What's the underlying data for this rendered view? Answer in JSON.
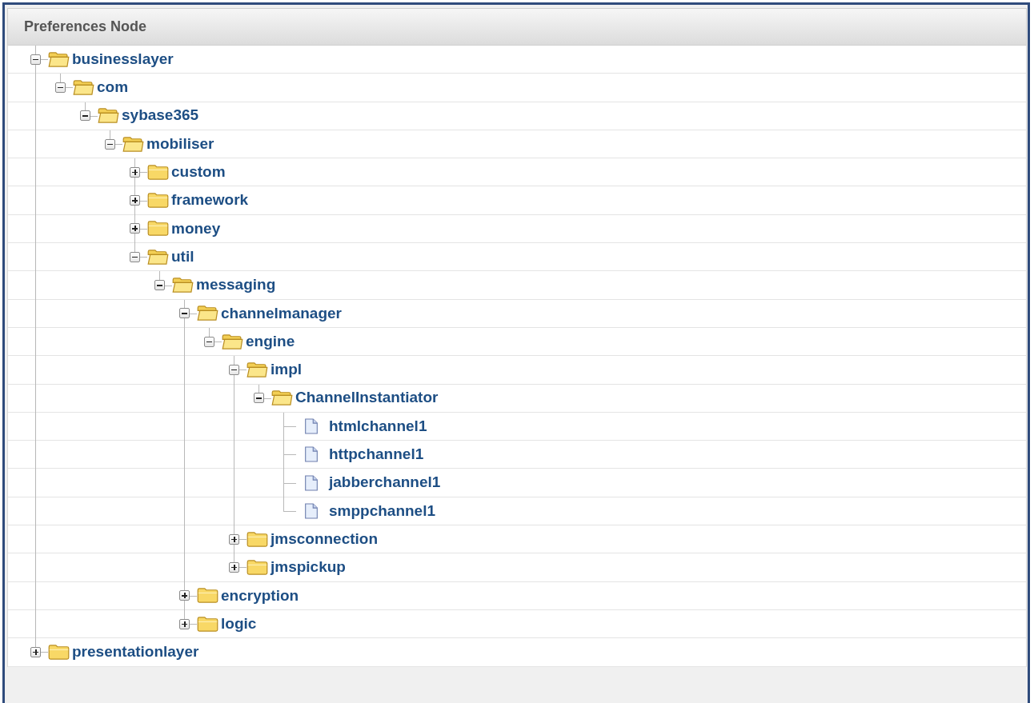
{
  "panel": {
    "title": "Preferences Node"
  },
  "tree": [
    {
      "name": "businesslayer",
      "kind": "folder",
      "expanded": true,
      "children": [
        {
          "name": "com",
          "kind": "folder",
          "expanded": true,
          "children": [
            {
              "name": "sybase365",
              "kind": "folder",
              "expanded": true,
              "children": [
                {
                  "name": "mobiliser",
                  "kind": "folder",
                  "expanded": true,
                  "children": [
                    {
                      "name": "custom",
                      "kind": "folder",
                      "expanded": false
                    },
                    {
                      "name": "framework",
                      "kind": "folder",
                      "expanded": false
                    },
                    {
                      "name": "money",
                      "kind": "folder",
                      "expanded": false
                    },
                    {
                      "name": "util",
                      "kind": "folder",
                      "expanded": true,
                      "children": [
                        {
                          "name": "messaging",
                          "kind": "folder",
                          "expanded": true,
                          "children": [
                            {
                              "name": "channelmanager",
                              "kind": "folder",
                              "expanded": true,
                              "children": [
                                {
                                  "name": "engine",
                                  "kind": "folder",
                                  "expanded": true,
                                  "children": [
                                    {
                                      "name": "impl",
                                      "kind": "folder",
                                      "expanded": true,
                                      "children": [
                                        {
                                          "name": "ChannelInstantiator",
                                          "kind": "folder",
                                          "expanded": true,
                                          "children": [
                                            {
                                              "name": "htmlchannel1",
                                              "kind": "file"
                                            },
                                            {
                                              "name": "httpchannel1",
                                              "kind": "file"
                                            },
                                            {
                                              "name": "jabberchannel1",
                                              "kind": "file"
                                            },
                                            {
                                              "name": "smppchannel1",
                                              "kind": "file"
                                            }
                                          ]
                                        }
                                      ]
                                    },
                                    {
                                      "name": "jmsconnection",
                                      "kind": "folder",
                                      "expanded": false
                                    },
                                    {
                                      "name": "jmspickup",
                                      "kind": "folder",
                                      "expanded": false
                                    }
                                  ]
                                }
                              ]
                            },
                            {
                              "name": "encryption",
                              "kind": "folder",
                              "expanded": false
                            },
                            {
                              "name": "logic",
                              "kind": "folder",
                              "expanded": false
                            }
                          ]
                        }
                      ]
                    }
                  ]
                }
              ]
            }
          ]
        }
      ]
    },
    {
      "name": "presentationlayer",
      "kind": "folder",
      "expanded": false
    }
  ]
}
